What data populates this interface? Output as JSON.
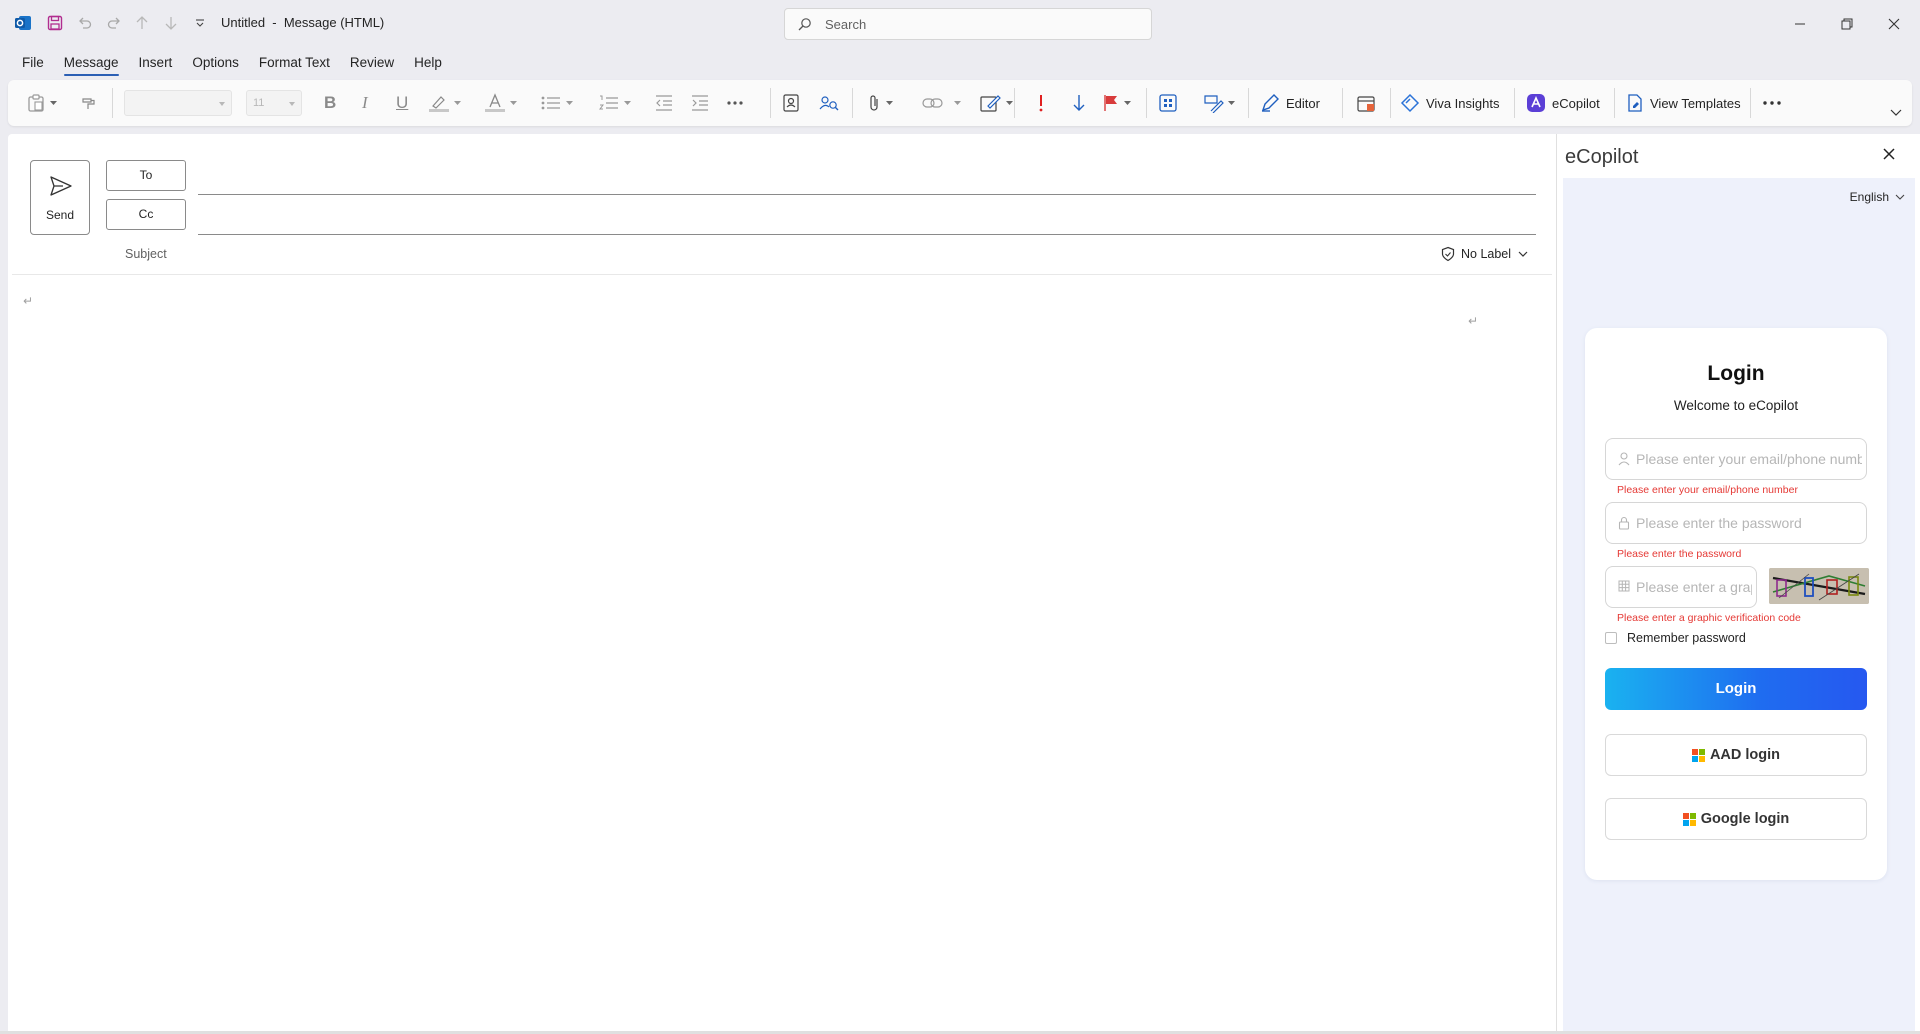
{
  "window": {
    "title": "Untitled  -  Message (HTML)",
    "search_placeholder": "Search"
  },
  "menu": [
    "File",
    "Message",
    "Insert",
    "Options",
    "Format Text",
    "Review",
    "Help"
  ],
  "ribbon": {
    "font_name": "",
    "font_size": "11",
    "editor": "Editor",
    "viva": "Viva Insights",
    "ecopilot": "eCopilot",
    "templates": "View Templates",
    "more": "···"
  },
  "compose": {
    "send": "Send",
    "to": "To",
    "cc": "Cc",
    "subject": "Subject",
    "sensitivity": "No Label",
    "pilcrow": "↵"
  },
  "pane": {
    "title": "eCopilot",
    "language": "English",
    "login_title": "Login",
    "welcome": "Welcome to eCopilot",
    "email_placeholder": "Please enter your email/phone number",
    "email_error": "Please enter your email/phone number",
    "password_placeholder": "Please enter the password",
    "password_error": "Please enter the password",
    "code_placeholder": "Please enter a graphic verification code",
    "code_error": "Please enter a graphic verification code",
    "remember": "Remember password",
    "login_button": "Login",
    "aad_login": "AAD login",
    "google_login": "Google login"
  },
  "colors": {
    "accent": "#2b5fb4",
    "error": "#e53935",
    "login_gradient_start": "#1ab2f0",
    "login_gradient_end": "#2658f0",
    "pane_background": "#eef1fb"
  }
}
